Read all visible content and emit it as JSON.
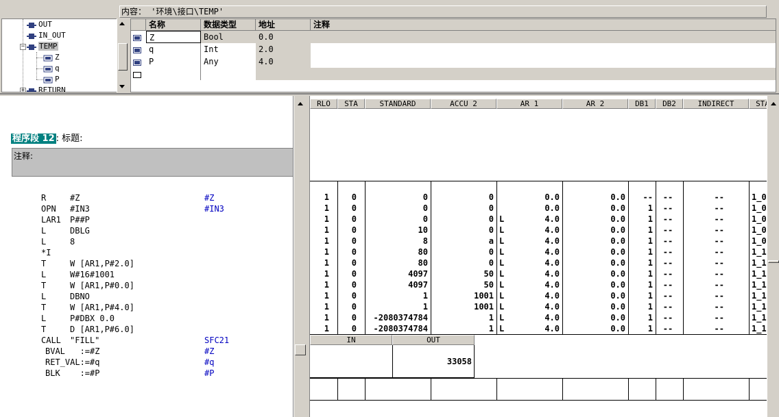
{
  "top": {
    "content_label": "内容：",
    "content_path": "'环境\\接口\\TEMP'"
  },
  "tree": {
    "items": [
      {
        "label": "OUT"
      },
      {
        "label": "IN_OUT"
      },
      {
        "label": "TEMP"
      },
      {
        "label": "Z"
      },
      {
        "label": "q"
      },
      {
        "label": "P"
      },
      {
        "label": "RETURN"
      }
    ]
  },
  "var_table": {
    "headers": {
      "name": "名称",
      "type": "数据类型",
      "address": "地址",
      "comment": "注释"
    },
    "rows": [
      {
        "name": "Z",
        "type": "Bool",
        "address": "0.0"
      },
      {
        "name": "q",
        "type": "Int",
        "address": "2.0"
      },
      {
        "name": "P",
        "type": "Any",
        "address": "4.0"
      }
    ]
  },
  "code": {
    "network_badge": "程序段 12",
    "network_label": ": 标题:",
    "comment_label": "注释:",
    "lines": [
      {
        "op": "R",
        "arg": "#Z",
        "addr": "#Z"
      },
      {
        "op": "OPN",
        "arg": "#IN3",
        "addr": "#IN3"
      },
      {
        "op": "LAR1",
        "arg": "P##P",
        "addr": ""
      },
      {
        "op": "L",
        "arg": "DBLG",
        "addr": ""
      },
      {
        "op": "L",
        "arg": "8",
        "addr": ""
      },
      {
        "op": "*I",
        "arg": "",
        "addr": ""
      },
      {
        "op": "T",
        "arg": "W [AR1,P#2.0]",
        "addr": ""
      },
      {
        "op": "L",
        "arg": "W#16#1001",
        "addr": ""
      },
      {
        "op": "T",
        "arg": "W [AR1,P#0.0]",
        "addr": ""
      },
      {
        "op": "L",
        "arg": "DBNO",
        "addr": ""
      },
      {
        "op": "T",
        "arg": "W [AR1,P#4.0]",
        "addr": ""
      },
      {
        "op": "L",
        "arg": "P#DBX 0.0",
        "addr": ""
      },
      {
        "op": "T",
        "arg": "D [AR1,P#6.0]",
        "addr": ""
      },
      {
        "op": "CALL",
        "arg": "\"FILL\"",
        "addr": "SFC21"
      }
    ],
    "params": [
      {
        "text": "BVAL   :=#Z",
        "addr": "#Z"
      },
      {
        "text": "RET_VAL:=#q",
        "addr": "#q"
      },
      {
        "text": "BLK    :=#P",
        "addr": "#P"
      }
    ]
  },
  "registers": {
    "headers": [
      "RLO",
      "STA",
      "STANDARD",
      "ACCU 2",
      "AR 1",
      "AR 2",
      "DB1",
      "DB2",
      "INDIRECT",
      "STA"
    ],
    "rows": [
      [
        "1",
        "0",
        "0",
        "0",
        "",
        "0.0",
        "0.0",
        "--",
        "--",
        "--",
        "1_0"
      ],
      [
        "1",
        "0",
        "0",
        "0",
        "",
        "0.0",
        "0.0",
        "1",
        "--",
        "--",
        "1_0"
      ],
      [
        "1",
        "0",
        "0",
        "0",
        "L",
        "4.0",
        "0.0",
        "1",
        "--",
        "--",
        "1_0"
      ],
      [
        "1",
        "0",
        "10",
        "0",
        "L",
        "4.0",
        "0.0",
        "1",
        "--",
        "--",
        "1_0"
      ],
      [
        "1",
        "0",
        "8",
        "a",
        "L",
        "4.0",
        "0.0",
        "1",
        "--",
        "--",
        "1_0"
      ],
      [
        "1",
        "0",
        "80",
        "0",
        "L",
        "4.0",
        "0.0",
        "1",
        "--",
        "--",
        "1_1"
      ],
      [
        "1",
        "0",
        "80",
        "0",
        "L",
        "4.0",
        "0.0",
        "1",
        "--",
        "--",
        "1_1"
      ],
      [
        "1",
        "0",
        "4097",
        "50",
        "L",
        "4.0",
        "0.0",
        "1",
        "--",
        "--",
        "1_1"
      ],
      [
        "1",
        "0",
        "4097",
        "50",
        "L",
        "4.0",
        "0.0",
        "1",
        "--",
        "--",
        "1_1"
      ],
      [
        "1",
        "0",
        "1",
        "1001",
        "L",
        "4.0",
        "0.0",
        "1",
        "--",
        "--",
        "1_1"
      ],
      [
        "1",
        "0",
        "1",
        "1001",
        "L",
        "4.0",
        "0.0",
        "1",
        "--",
        "--",
        "1_1"
      ],
      [
        "1",
        "0",
        "-2080374784",
        "1",
        "L",
        "4.0",
        "0.0",
        "1",
        "--",
        "--",
        "1_1"
      ],
      [
        "1",
        "0",
        "-2080374784",
        "1",
        "L",
        "4.0",
        "0.0",
        "1",
        "--",
        "--",
        "1_1"
      ]
    ],
    "io_headers": {
      "in": "IN",
      "out": "OUT"
    },
    "out_value": "33058"
  }
}
